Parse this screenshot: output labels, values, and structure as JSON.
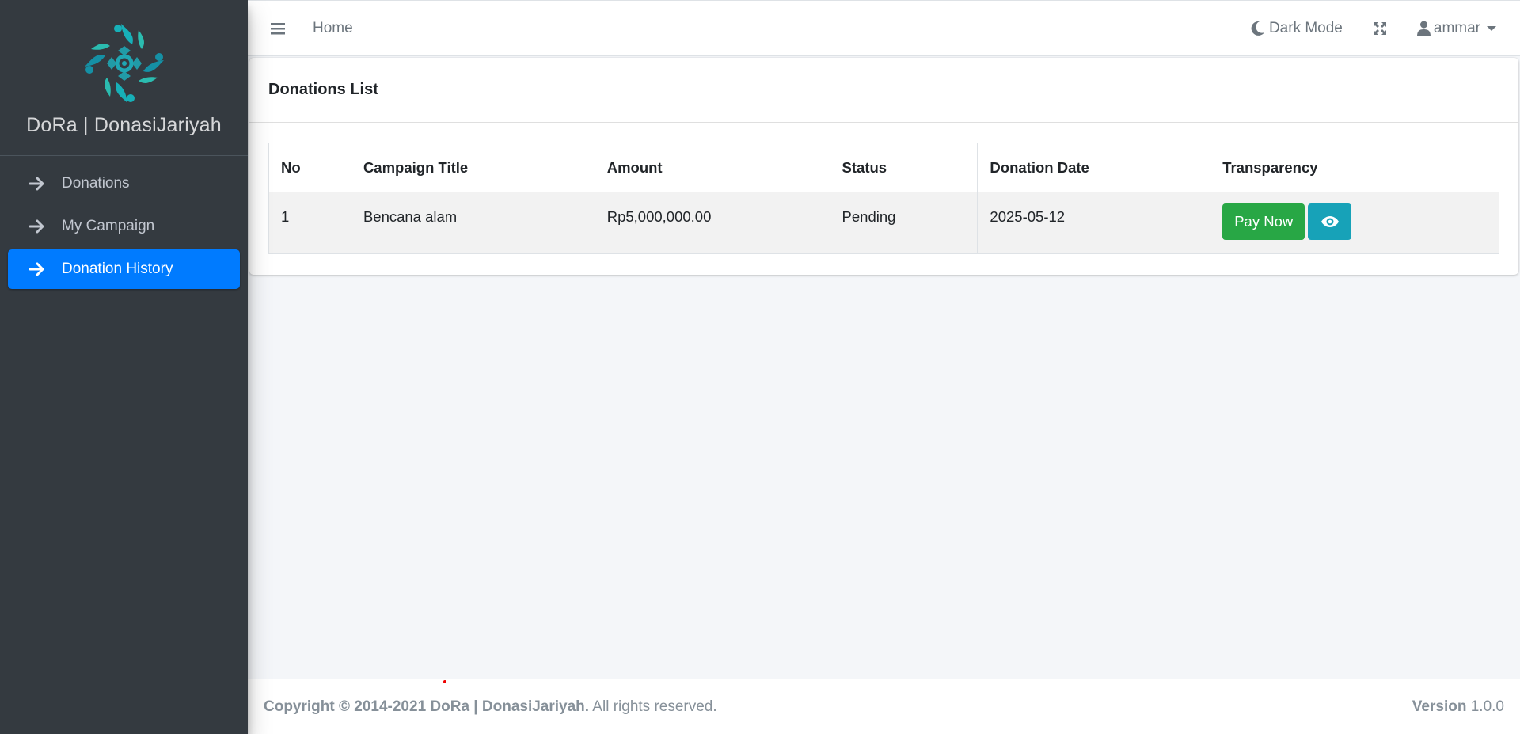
{
  "brand": {
    "name": "DoRa | DonasiJariyah",
    "logo_icon": "dora-logo-icon",
    "logo_color": "#1fa6b3"
  },
  "sidebar": {
    "items": [
      {
        "label": "Donations",
        "icon": "arrow-right-icon",
        "active": false
      },
      {
        "label": "My Campaign",
        "icon": "arrow-right-icon",
        "active": false
      },
      {
        "label": "Donation History",
        "icon": "arrow-right-icon",
        "active": true
      }
    ],
    "active_color": "#007bff"
  },
  "topbar": {
    "menu_icon": "hamburger-icon",
    "home_label": "Home",
    "dark_mode_label": "Dark Mode",
    "dark_mode_icon": "moon-icon",
    "fullscreen_icon": "expand-icon",
    "user_icon": "user-icon",
    "user_name": "ammar"
  },
  "card": {
    "title": "Donations List"
  },
  "table": {
    "headers": [
      "No",
      "Campaign Title",
      "Amount",
      "Status",
      "Donation Date",
      "Transparency"
    ],
    "rows": [
      {
        "no": "1",
        "campaign_title": "Bencana alam",
        "amount": "Rp5,000,000.00",
        "status": "Pending",
        "donation_date": "2025-05-12",
        "pay_label": "Pay Now",
        "view_icon": "eye-icon"
      }
    ]
  },
  "buttons": {
    "pay_color": "#28a745",
    "view_color": "#17a2b8"
  },
  "footer": {
    "copyright_bold": "Copyright © 2014-2021 DoRa | DonasiJariyah.",
    "rights": " All rights reserved.",
    "version_label": "Version",
    "version_value": " 1.0.0"
  }
}
